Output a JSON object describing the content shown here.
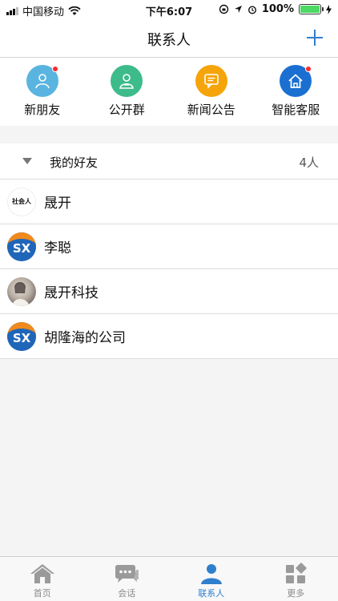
{
  "status_bar": {
    "carrier": "中国移动",
    "time": "下午6:07",
    "battery": "100%"
  },
  "header": {
    "title": "联系人",
    "add_icon": "plus-icon"
  },
  "quick_actions": [
    {
      "label": "新朋友",
      "icon": "person-add-icon",
      "color": "#5ab4e0",
      "badge": true
    },
    {
      "label": "公开群",
      "icon": "group-icon",
      "color": "#3dbb8b",
      "badge": false
    },
    {
      "label": "新闻公告",
      "icon": "message-icon",
      "color": "#f5a40a",
      "badge": false
    },
    {
      "label": "智能客服",
      "icon": "home-icon",
      "color": "#1b6fd1",
      "badge": true
    }
  ],
  "friend_group": {
    "name": "我的好友",
    "count": "4人"
  },
  "contacts": [
    {
      "name": "晟开",
      "avatar_text": "社会人"
    },
    {
      "name": "李聪",
      "avatar_text": "SX"
    },
    {
      "name": "晟开科技",
      "avatar_text": ""
    },
    {
      "name": "胡隆海的公司",
      "avatar_text": "SX"
    }
  ],
  "tabs": [
    {
      "label": "首页",
      "icon": "home-icon"
    },
    {
      "label": "会话",
      "icon": "chat-icon"
    },
    {
      "label": "联系人",
      "icon": "contacts-icon"
    },
    {
      "label": "更多",
      "icon": "grid-icon"
    }
  ],
  "colors": {
    "accent": "#2f7fcd",
    "badge": "#ff2b2b"
  }
}
